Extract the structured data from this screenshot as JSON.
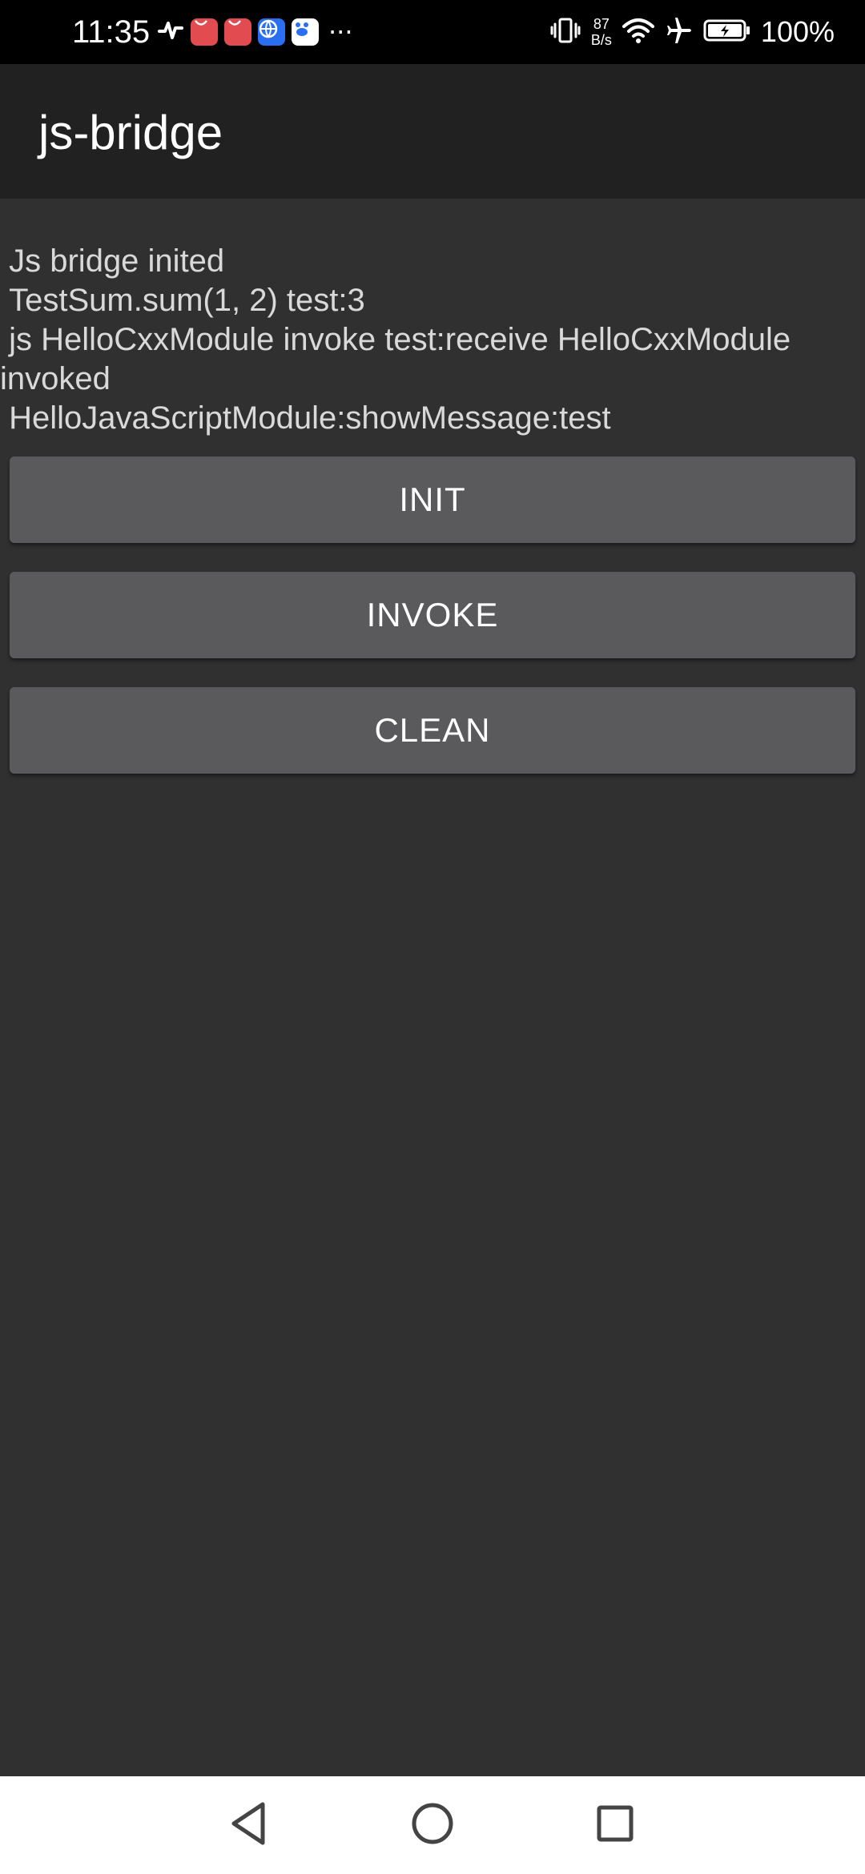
{
  "status_bar": {
    "time": "11:35",
    "net_speed_value": "87",
    "net_speed_unit": "B/s",
    "battery": "100%",
    "more": "···",
    "icons": [
      "heart-rate-icon",
      "huawei-app-icon",
      "huawei-app-icon",
      "browser-icon",
      "baidu-icon",
      "vibrate-icon",
      "wifi-icon",
      "airplane-icon",
      "battery-charging-icon"
    ],
    "background": "#000000"
  },
  "app_bar": {
    "title": "js-bridge",
    "background": "#212121"
  },
  "log": {
    "text": " Js bridge inited\n TestSum.sum(1, 2) test:3\n js HelloCxxModule invoke test:receive HelloCxxModule invoked\n HelloJavaScriptModule:showMessage:test",
    "color": "#d9d9d9"
  },
  "buttons": {
    "init": "INIT",
    "invoke": "INVOKE",
    "clean": "CLEAN",
    "background": "#5a5a5c"
  },
  "nav_bar": {
    "icons": [
      "back-icon",
      "home-icon",
      "recents-icon"
    ],
    "background": "#ffffff"
  }
}
